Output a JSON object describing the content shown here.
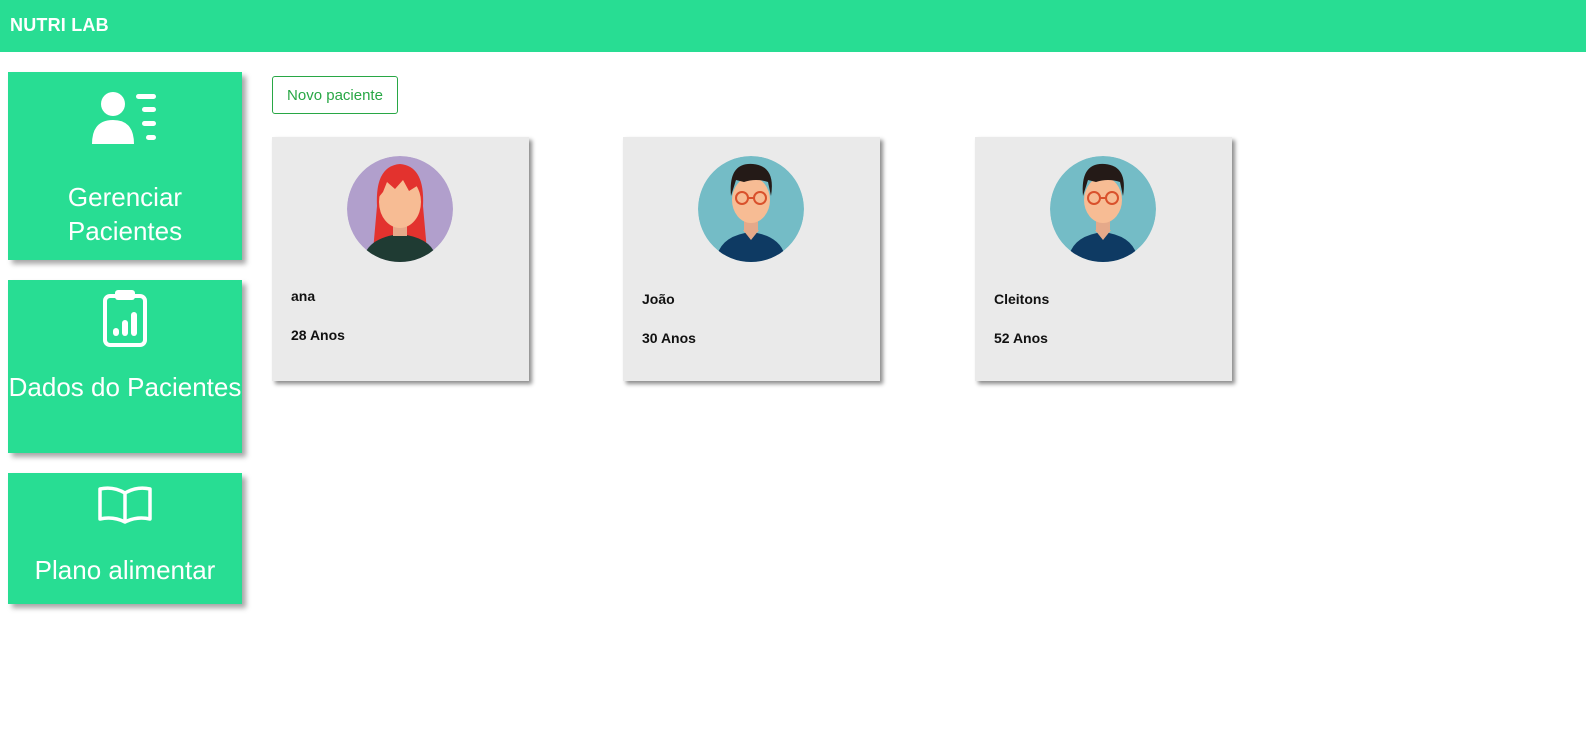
{
  "header": {
    "brand": "NUTRI LAB"
  },
  "sidebar": {
    "items": [
      {
        "label": "Gerenciar Pacientes",
        "icon": "patient-list-icon"
      },
      {
        "label": "Dados do Pacientes",
        "icon": "clipboard-chart-icon"
      },
      {
        "label": "Plano alimentar",
        "icon": "open-book-icon"
      }
    ]
  },
  "main": {
    "new_patient_label": "Novo paciente",
    "patients": [
      {
        "name": "ana",
        "age": "28 Anos",
        "avatar": "female-avatar-icon"
      },
      {
        "name": "João",
        "age": "30 Anos",
        "avatar": "male-avatar-icon"
      },
      {
        "name": "Cleitons",
        "age": "52 Anos",
        "avatar": "male-avatar-icon"
      }
    ]
  },
  "colors": {
    "accent": "#28dd93",
    "button_border": "#28a745",
    "card_bg": "#eaeaea"
  }
}
